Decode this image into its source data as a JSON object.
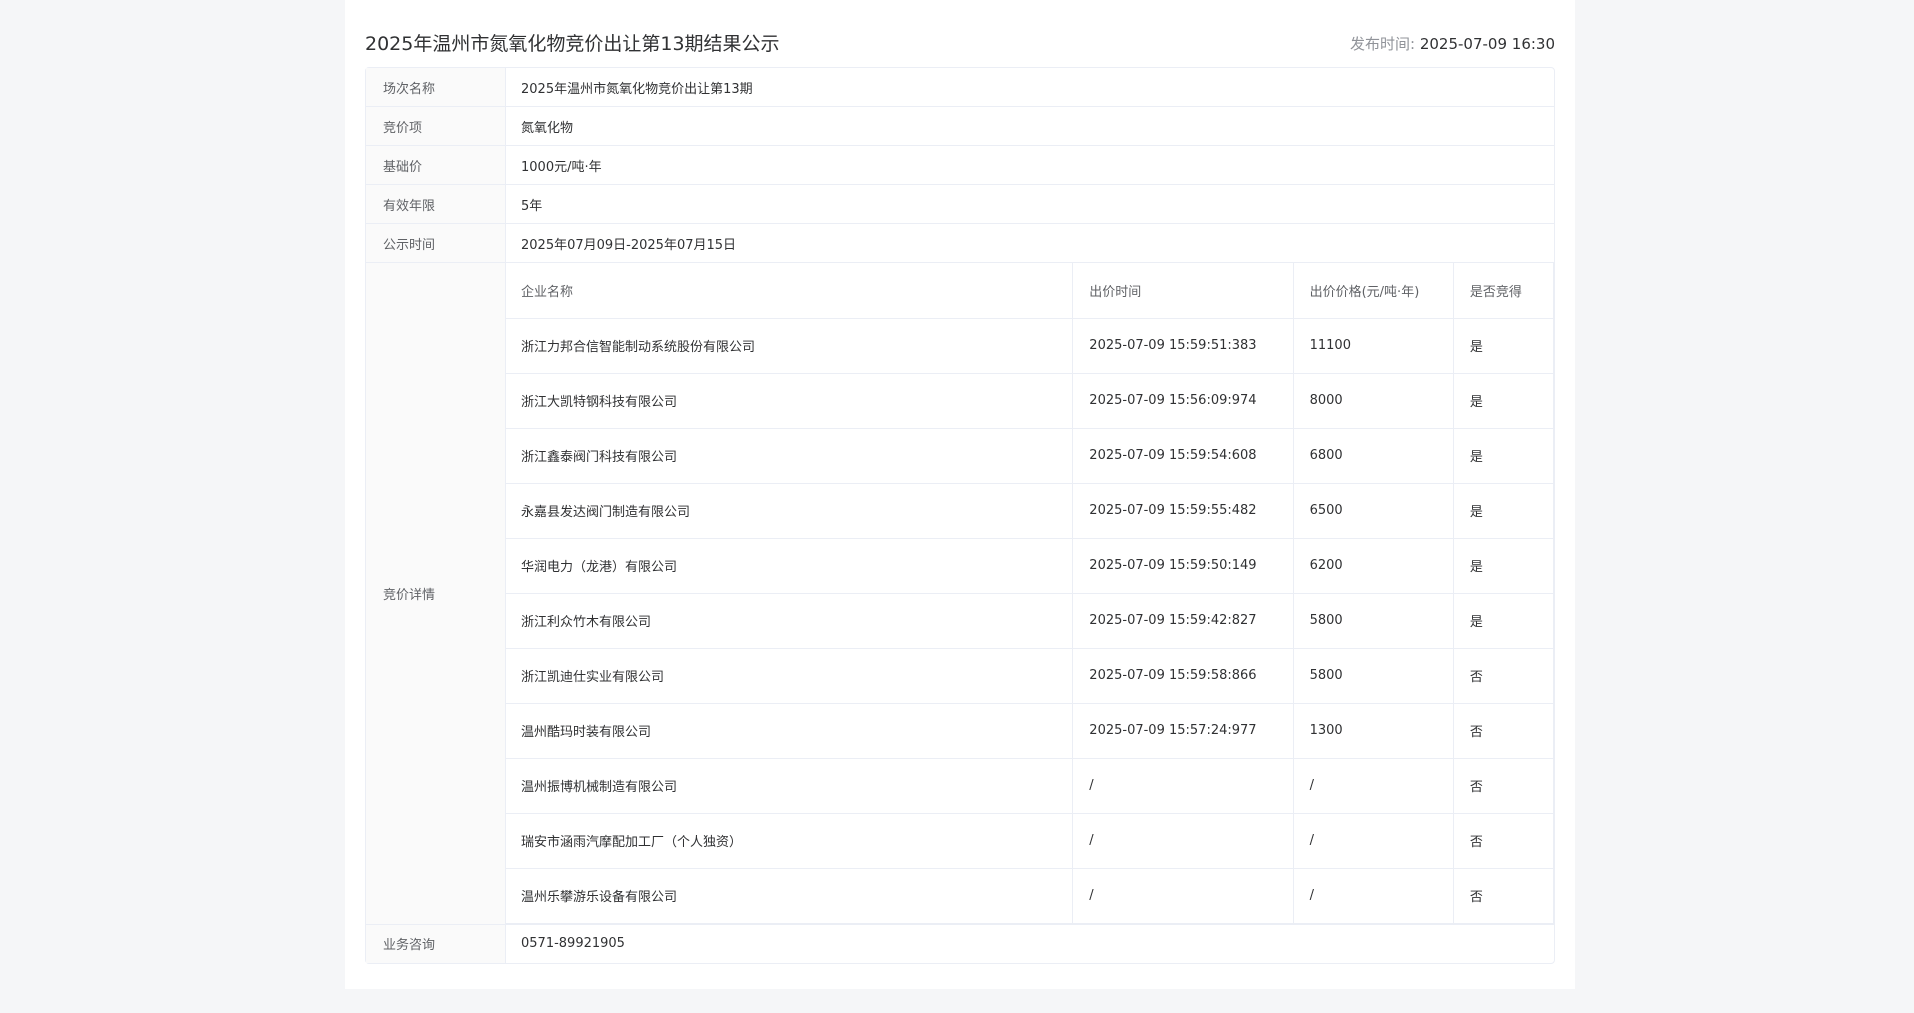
{
  "page": {
    "title": "2025年温州市氮氧化物竞价出让第13期结果公示",
    "publish_label": "发布时间:",
    "publish_time": "2025-07-09 16:30"
  },
  "info": {
    "session_label": "场次名称",
    "session_value": "2025年温州市氮氧化物竞价出让第13期",
    "item_label": "竞价项",
    "item_value": "氮氧化物",
    "base_price_label": "基础价",
    "base_price_value": "1000元/吨·年",
    "validity_label": "有效年限",
    "validity_value": "5年",
    "notice_period_label": "公示时间",
    "notice_period_value": "2025年07月09日-2025年07月15日",
    "details_label": "竞价详情",
    "consult_label": "业务咨询",
    "consult_value": "0571-89921905"
  },
  "bids": {
    "columns": [
      "企业名称",
      "出价时间",
      "出价价格(元/吨·年)",
      "是否竞得"
    ],
    "rows": [
      {
        "company": "浙江力邦合信智能制动系统股份有限公司",
        "time": "2025-07-09 15:59:51:383",
        "price": "11100",
        "won": "是"
      },
      {
        "company": "浙江大凯特钢科技有限公司",
        "time": "2025-07-09 15:56:09:974",
        "price": "8000",
        "won": "是"
      },
      {
        "company": "浙江鑫泰阀门科技有限公司",
        "time": "2025-07-09 15:59:54:608",
        "price": "6800",
        "won": "是"
      },
      {
        "company": "永嘉县发达阀门制造有限公司",
        "time": "2025-07-09 15:59:55:482",
        "price": "6500",
        "won": "是"
      },
      {
        "company": "华润电力（龙港）有限公司",
        "time": "2025-07-09 15:59:50:149",
        "price": "6200",
        "won": "是"
      },
      {
        "company": "浙江利众竹木有限公司",
        "time": "2025-07-09 15:59:42:827",
        "price": "5800",
        "won": "是"
      },
      {
        "company": "浙江凯迪仕实业有限公司",
        "time": "2025-07-09 15:59:58:866",
        "price": "5800",
        "won": "否"
      },
      {
        "company": "温州酷玛时装有限公司",
        "time": "2025-07-09 15:57:24:977",
        "price": "1300",
        "won": "否"
      },
      {
        "company": "温州振博机械制造有限公司",
        "time": "/",
        "price": "/",
        "won": "否"
      },
      {
        "company": "瑞安市涵雨汽摩配加工厂（个人独资）",
        "time": "/",
        "price": "/",
        "won": "否"
      },
      {
        "company": "温州乐攀游乐设备有限公司",
        "time": "/",
        "price": "/",
        "won": "否"
      }
    ]
  }
}
